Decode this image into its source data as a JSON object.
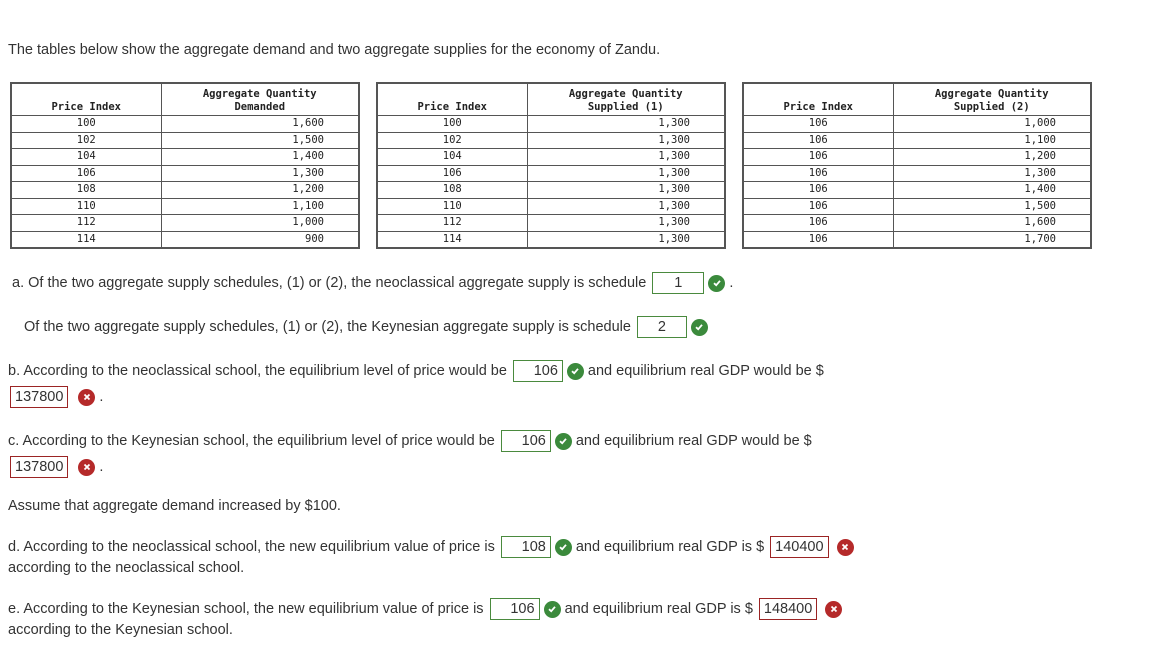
{
  "intro": "The tables below show the aggregate demand and two aggregate supplies for the economy of Zandu.",
  "tables": [
    {
      "headers": [
        "Price Index",
        "Aggregate Quantity",
        "Demanded"
      ],
      "rows": [
        [
          "100",
          "1,600"
        ],
        [
          "102",
          "1,500"
        ],
        [
          "104",
          "1,400"
        ],
        [
          "106",
          "1,300"
        ],
        [
          "108",
          "1,200"
        ],
        [
          "110",
          "1,100"
        ],
        [
          "112",
          "1,000"
        ],
        [
          "114",
          "900"
        ]
      ]
    },
    {
      "headers": [
        "Price Index",
        "Aggregate Quantity",
        "Supplied (1)"
      ],
      "rows": [
        [
          "100",
          "1,300"
        ],
        [
          "102",
          "1,300"
        ],
        [
          "104",
          "1,300"
        ],
        [
          "106",
          "1,300"
        ],
        [
          "108",
          "1,300"
        ],
        [
          "110",
          "1,300"
        ],
        [
          "112",
          "1,300"
        ],
        [
          "114",
          "1,300"
        ]
      ]
    },
    {
      "headers": [
        "Price Index",
        "Aggregate Quantity",
        "Supplied (2)"
      ],
      "rows": [
        [
          "106",
          "1,000"
        ],
        [
          "106",
          "1,100"
        ],
        [
          "106",
          "1,200"
        ],
        [
          "106",
          "1,300"
        ],
        [
          "106",
          "1,400"
        ],
        [
          "106",
          "1,500"
        ],
        [
          "106",
          "1,600"
        ],
        [
          "106",
          "1,700"
        ]
      ]
    }
  ],
  "questions": {
    "a1": {
      "text": "a. Of the two aggregate supply schedules, (1) or (2), the neoclassical aggregate supply is schedule",
      "answer": "1",
      "status": "correct",
      "suffix": "."
    },
    "a2": {
      "text": "Of the two aggregate supply schedules, (1) or (2), the Keynesian aggregate supply is schedule",
      "answer": "2",
      "status": "correct"
    },
    "b": {
      "text": "b. According to the neoclassical school, the equilibrium level of price would be",
      "answer1": "106",
      "status1": "correct",
      "mid": "and equilibrium real GDP would be $",
      "answer2": "137800",
      "status2": "incorrect",
      "suffix": "."
    },
    "c": {
      "text": "c. According to the Keynesian school, the equilibrium level of price would be",
      "answer1": "106",
      "status1": "correct",
      "mid": "and equilibrium real GDP would be $",
      "answer2": "137800",
      "status2": "incorrect",
      "suffix": "."
    },
    "assume": "Assume that aggregate demand increased by $100.",
    "d": {
      "text": "d. According to the neoclassical school, the new equilibrium value of price is",
      "answer1": "108",
      "status1": "correct",
      "mid": "and equilibrium real GDP is $",
      "answer2": "140400",
      "status2": "incorrect",
      "tail": "according to the neoclassical school."
    },
    "e": {
      "text": "e. According to the Keynesian school, the new equilibrium value of price is",
      "answer1": "106",
      "status1": "correct",
      "mid": "and equilibrium real GDP is $",
      "answer2": "148400",
      "status2": "incorrect",
      "tail": "according to the Keynesian school."
    }
  },
  "colors": {
    "correct": "#3b8a3c",
    "incorrect": "#b52a2a"
  }
}
